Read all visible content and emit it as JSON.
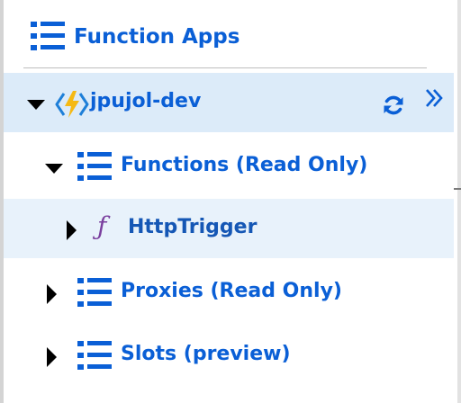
{
  "header": {
    "title": "Function Apps",
    "icon": "list-icon"
  },
  "tree": {
    "app": {
      "label": "jpujol-dev",
      "icon": "function-app-icon",
      "refresh_icon": "refresh-icon",
      "expand_icon": "double-chevron-right-icon",
      "expanded": true,
      "selected": true
    },
    "functions": {
      "label": "Functions (Read Only)",
      "expanded": true
    },
    "http_trigger": {
      "label": "HttpTrigger",
      "icon_glyph": "ƒ",
      "expanded": false
    },
    "proxies": {
      "label": "Proxies (Read Only)",
      "expanded": false
    },
    "slots": {
      "label": "Slots (preview)",
      "expanded": false
    }
  },
  "colors": {
    "accent": "#0a5fd6",
    "selected_bg": "#dcebf9",
    "hover_bg": "#e8f2fb",
    "function_icon": "#7a3f9e",
    "caret": "#000000"
  }
}
